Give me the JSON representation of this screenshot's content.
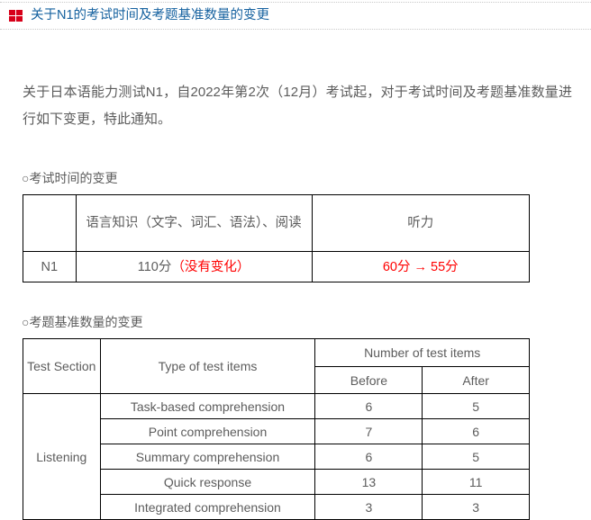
{
  "header": {
    "icon": "grid-2x2-icon",
    "title": "关于N1的考试时间及考题基准数量的变更",
    "title_color": "#15619f",
    "icon_color": "#d70019"
  },
  "intro": {
    "paragraph": "关于日本语能力测试N1，自2022年第2次（12月）考试起，对于考试时间及考题基准数量进行如下变更，特此通知。"
  },
  "section_exam_time": {
    "heading": "○考试时间的变更",
    "table": {
      "header": [
        "",
        "语言知识（文字、词汇、语法）、阅读",
        "听力"
      ],
      "rows": [
        {
          "label": "N1",
          "subject_main": "110分",
          "subject_note": "（没有变化）",
          "listening": "60分 → 55分"
        }
      ]
    }
  },
  "section_item_counts": {
    "heading": "○考题基准数量的变更",
    "table": {
      "header": {
        "test_section": "Test Section",
        "type_of_items": "Type of test items",
        "number_of_items": "Number of test items",
        "before": "Before",
        "after": "After"
      },
      "section_label": "Listening",
      "rows": [
        {
          "type": "Task-based comprehension",
          "before": "6",
          "after": "5"
        },
        {
          "type": "Point comprehension",
          "before": "7",
          "after": "6"
        },
        {
          "type": "Summary comprehension",
          "before": "6",
          "after": "5"
        },
        {
          "type": "Quick response",
          "before": "13",
          "after": "11"
        },
        {
          "type": "Integrated comprehension",
          "before": "3",
          "after": "3"
        }
      ]
    }
  },
  "colors": {
    "accent_red": "#ff0000",
    "title_blue": "#15619f",
    "text_gray": "#5c5c5c",
    "border": "#000000"
  }
}
